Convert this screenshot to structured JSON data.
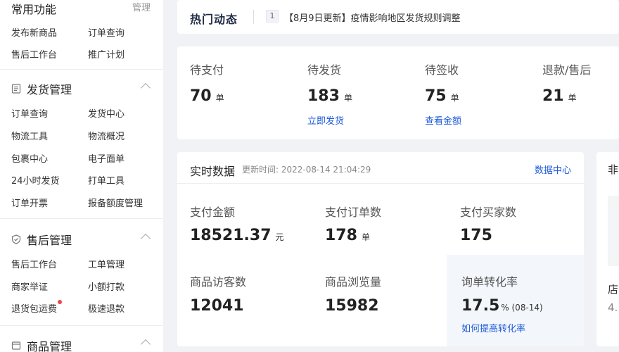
{
  "sidebar": {
    "common": {
      "title": "常用功能",
      "manage_label": "管理",
      "items": [
        "发布新商品",
        "订单查询",
        "售后工作台",
        "推广计划"
      ]
    },
    "shipping": {
      "title": "发货管理",
      "items": [
        "订单查询",
        "发货中心",
        "物流工具",
        "物流概况",
        "包裹中心",
        "电子面单",
        "24小时发货",
        "打单工具",
        "订单开票",
        "报备额度管理"
      ]
    },
    "aftersale": {
      "title": "售后管理",
      "items": [
        "售后工作台",
        "工单管理",
        "商家举证",
        "小额打款",
        "退货包运费",
        "极速退款"
      ]
    },
    "product": {
      "title": "商品管理"
    }
  },
  "hot": {
    "title": "热门动态",
    "index": "1",
    "text": "【8月9日更新】疫情影响地区发货规则调整"
  },
  "orders": [
    {
      "label": "待支付",
      "value": "70",
      "unit": "单",
      "link": ""
    },
    {
      "label": "待发货",
      "value": "183",
      "unit": "单",
      "link": "立即发货"
    },
    {
      "label": "待签收",
      "value": "75",
      "unit": "单",
      "link": "查看金额"
    },
    {
      "label": "退款/售后",
      "value": "21",
      "unit": "单",
      "link": ""
    }
  ],
  "realtime": {
    "title": "实时数据",
    "updated": "更新时间: 2022-08-14 21:04:29",
    "link": "数据中心",
    "metrics": [
      {
        "label": "支付金额",
        "value": "18521.37",
        "unit": "元"
      },
      {
        "label": "支付订单数",
        "value": "178",
        "unit": "单"
      },
      {
        "label": "支付买家数",
        "value": "175",
        "unit": ""
      },
      {
        "label": "商品访客数",
        "value": "12041",
        "unit": ""
      },
      {
        "label": "商品浏览量",
        "value": "15982",
        "unit": ""
      },
      {
        "label": "询单转化率",
        "value": "17.5",
        "unit": "% (08-14)",
        "link": "如何提高转化率"
      }
    ]
  },
  "right_card": {
    "title": "非",
    "label": "店",
    "value": "4."
  }
}
